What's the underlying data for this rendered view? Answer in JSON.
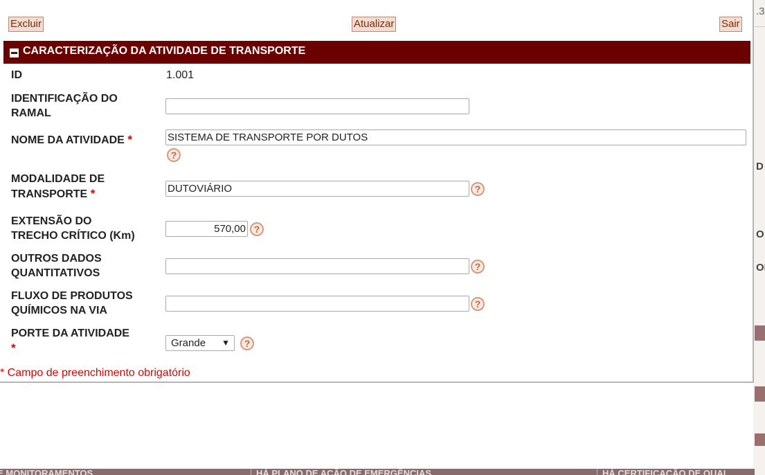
{
  "toolbar": {
    "delete_label": "Excluir",
    "refresh_label": "Atualizar",
    "exit_label": "Sair"
  },
  "section": {
    "title": "CARACTERIZAÇÃO DA ATIVIDADE DE TRANSPORTE",
    "collapse_icon": "minus-box-icon"
  },
  "form": {
    "id": {
      "label": "ID",
      "value": "1.001"
    },
    "branch_id": {
      "label_line1": "IDENTIFICAÇÃO DO",
      "label_line2": "RAMAL",
      "value": ""
    },
    "activity_name": {
      "label": "NOME DA ATIVIDADE",
      "required_mark": "*",
      "value": "SISTEMA DE TRANSPORTE POR DUTOS"
    },
    "transport_mode": {
      "label_line1": "MODALIDADE DE",
      "label_line2": "TRANSPORTE",
      "required_mark": "*",
      "value": "DUTOVIÁRIO"
    },
    "critical_length": {
      "label_line1": "EXTENSÃO DO",
      "label_line2": "TRECHO CRÍTICO (Km)",
      "value": "570,00"
    },
    "other_data": {
      "label_line1": "OUTROS DADOS",
      "label_line2": "QUANTITATIVOS",
      "value": ""
    },
    "chemical_flow": {
      "label_line1": "FLUXO DE PRODUTOS",
      "label_line2": "QUÍMICOS NA VIA",
      "value": ""
    },
    "activity_size": {
      "label": "PORTE DA ATIVIDADE",
      "required_mark": "*",
      "selected": "Grande"
    },
    "help_glyph": "?"
  },
  "footnote": "* Campo de preenchimento obrigatório",
  "background": {
    "right_fragments": [
      ".3",
      "D",
      "O",
      "OD"
    ],
    "bottom_fragments": [
      "E MONITORAMENTOS",
      "HÁ PLANO DE AÇÃO DE EMERGÊNCIAS",
      "HÁ CERTIFICAÇÃO DE QUAL"
    ]
  },
  "colors": {
    "header_bg": "#6b0000",
    "button_bg": "#f3ddd0",
    "required": "#e00000",
    "help_icon": "#d69a7a"
  }
}
